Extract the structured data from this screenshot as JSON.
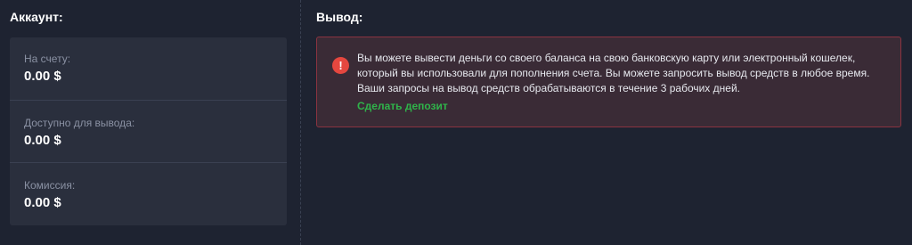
{
  "account": {
    "title": "Аккаунт:",
    "stats": [
      {
        "label": "На счету:",
        "value": "0.00 $"
      },
      {
        "label": "Доступно для вывода:",
        "value": "0.00 $"
      },
      {
        "label": "Комиссия:",
        "value": "0.00 $"
      }
    ]
  },
  "withdraw": {
    "title": "Вывод:",
    "alert": {
      "icon": "exclamation-icon",
      "icon_glyph": "!",
      "text": "Вы можете вывести деньги со своего баланса на свою банковскую карту или электронный кошелек, который вы использовали для пополнения счета. Вы можете запросить вывод средств в любое время. Ваши запросы на вывод средств обрабатываются в течение 3 рабочих дней.",
      "link_label": "Сделать депозит"
    }
  },
  "colors": {
    "background": "#1e2331",
    "card": "#2a2f3d",
    "alert_background": "#3a2b36",
    "alert_border": "#8a3340",
    "alert_icon": "#e5473f",
    "link": "#2fb34a",
    "muted_text": "#8a91a3"
  }
}
